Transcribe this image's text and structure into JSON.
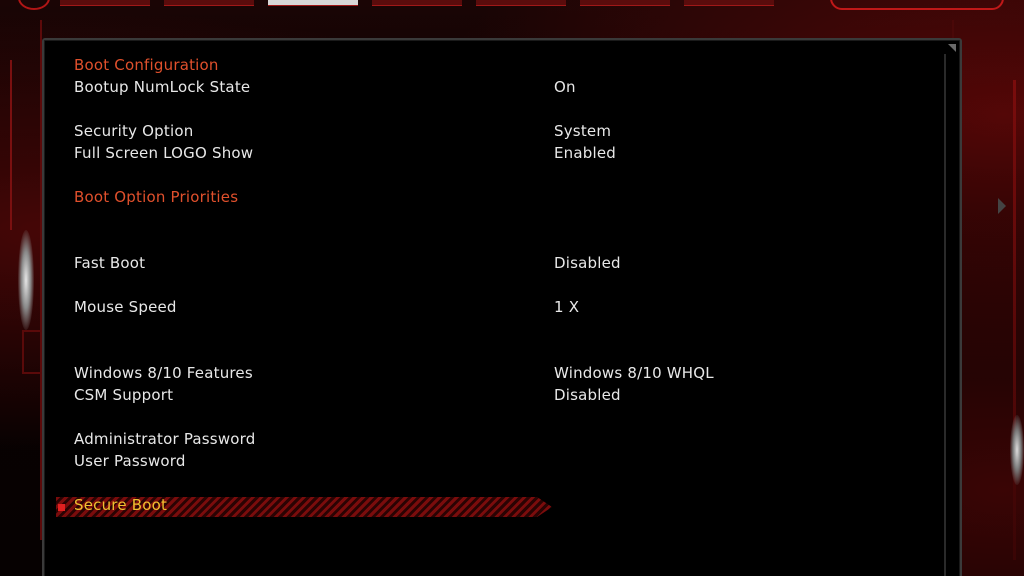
{
  "settings": [
    {
      "label": "Boot Configuration",
      "value": "",
      "kind": "header"
    },
    {
      "label": "Bootup NumLock State",
      "value": "On",
      "kind": "option"
    },
    {
      "label": "Security Option",
      "value": "System",
      "kind": "option"
    },
    {
      "label": "Full Screen LOGO Show",
      "value": "Enabled",
      "kind": "option"
    },
    {
      "label": "Boot Option Priorities",
      "value": "",
      "kind": "submenu"
    },
    {
      "label": "Fast Boot",
      "value": "Disabled",
      "kind": "option"
    },
    {
      "label": "Mouse Speed",
      "value": "1 X",
      "kind": "option"
    },
    {
      "label": "Windows 8/10 Features",
      "value": "Windows 8/10 WHQL",
      "kind": "option"
    },
    {
      "label": "CSM Support",
      "value": "Disabled",
      "kind": "option"
    },
    {
      "label": "Administrator Password",
      "value": "",
      "kind": "option"
    },
    {
      "label": "User Password",
      "value": "",
      "kind": "option"
    },
    {
      "label": "Secure Boot",
      "value": "",
      "kind": "submenu",
      "selected": true
    }
  ],
  "colors": {
    "section_header": "#e0502c",
    "selected_text": "#f0c030",
    "text": "#e8e8e8",
    "accent_red": "#b01515"
  }
}
